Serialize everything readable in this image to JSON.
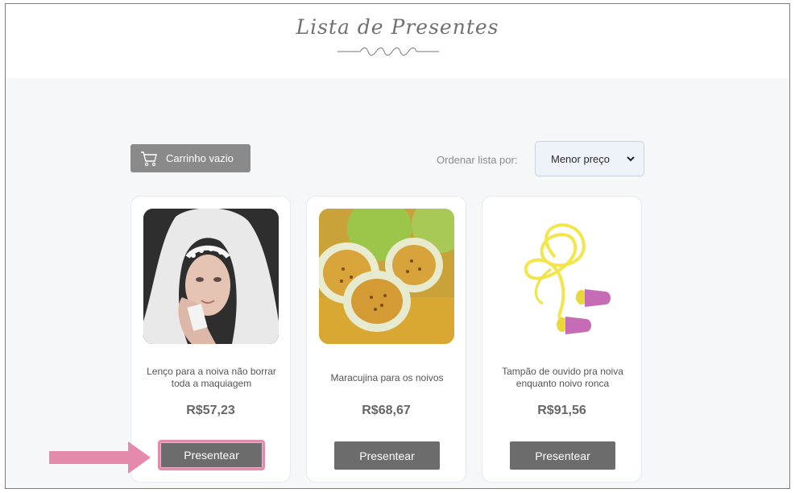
{
  "header": {
    "logo_title": "Lista de Presentes"
  },
  "toolbar": {
    "cart_label": "Carrinho vazio",
    "sort_label": "Ordenar lista por:",
    "sort_selected": "Menor preço"
  },
  "products": [
    {
      "name": "Lenço para a noiva não borrar toda a maquiagem",
      "price": "R$57,23",
      "button": "Presentear"
    },
    {
      "name": "Maracujina para os noivos",
      "price": "R$68,67",
      "button": "Presentear"
    },
    {
      "name": "Tampão de ouvido pra noiva enquanto noivo ronca",
      "price": "R$91,56",
      "button": "Presentear"
    }
  ],
  "colors": {
    "page_bg": "#f5f7f9",
    "button_bg": "#6c6c6c",
    "highlight": "#e58aac",
    "cart_bg": "#8a8a8a"
  },
  "icons": [
    "cart-icon",
    "chevron-down-icon",
    "pointer-arrow-icon",
    "ornament-swirl-icon"
  ]
}
